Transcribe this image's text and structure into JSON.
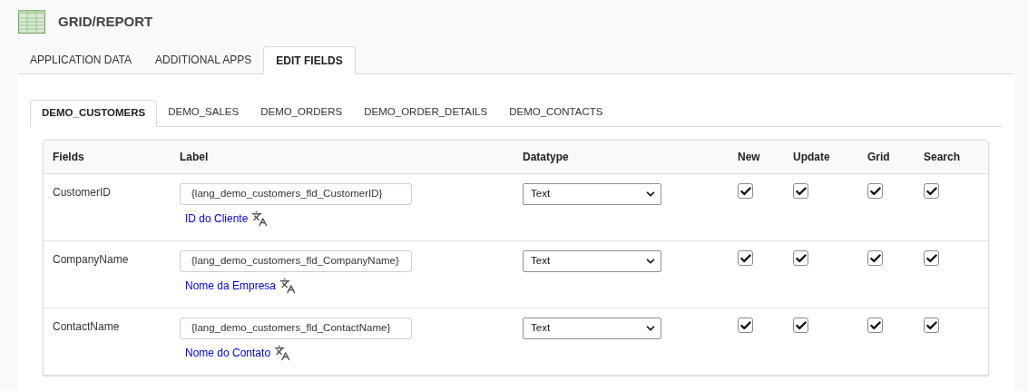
{
  "header": {
    "title": "GRID/REPORT"
  },
  "tabs": [
    {
      "label": "APPLICATION DATA",
      "selected": false
    },
    {
      "label": "ADDITIONAL APPS",
      "selected": false
    },
    {
      "label": "EDIT FIELDS",
      "selected": true
    }
  ],
  "subtabs": [
    {
      "label": "DEMO_CUSTOMERS",
      "selected": true
    },
    {
      "label": "DEMO_SALES",
      "selected": false
    },
    {
      "label": "DEMO_ORDERS",
      "selected": false
    },
    {
      "label": "DEMO_ORDER_DETAILS",
      "selected": false
    },
    {
      "label": "DEMO_CONTACTS",
      "selected": false
    }
  ],
  "table": {
    "columns": [
      "Fields",
      "Label",
      "Datatype",
      "New",
      "Update",
      "Grid",
      "Search"
    ],
    "rows": [
      {
        "field": "CustomerID",
        "label": "{lang_demo_customers_fld_CustomerID}",
        "translation": "ID do Cliente",
        "datatype": "Text",
        "new": true,
        "update": true,
        "grid": true,
        "search": true
      },
      {
        "field": "CompanyName",
        "label": "{lang_demo_customers_fld_CompanyName}",
        "translation": "Nome da Empresa",
        "datatype": "Text",
        "new": true,
        "update": true,
        "grid": true,
        "search": true
      },
      {
        "field": "ContactName",
        "label": "{lang_demo_customers_fld_ContactName}",
        "translation": "Nome do Contato",
        "datatype": "Text",
        "new": true,
        "update": true,
        "grid": true,
        "search": true
      }
    ]
  }
}
